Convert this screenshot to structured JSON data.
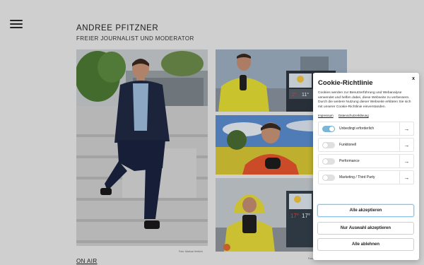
{
  "site": {
    "title": "ANDREE PFITZNER",
    "subtitle": "FREIER JOURNALIST UND MODERATOR",
    "on_air": "ON AIR"
  },
  "photos": {
    "main_credit": "Foto: Markus Hertrich",
    "br_credit": "Foto: SWR/Peter"
  },
  "cookie": {
    "close": "x",
    "title": "Cookie-Richtlinie",
    "text": "Cookies werden zur Benutzerführung und Webanalyse verwendet und helfen dabei, diese Webseite zu verbessern. Durch die weitere Nutzung dieser Webseite erklären Sie sich mit unserer Cookie-Richtlinie einverstanden.",
    "links": [
      "Impressum",
      "Datenschutzerklärung"
    ],
    "categories": [
      {
        "label": "Unbedingt erforderlich",
        "enabled": true
      },
      {
        "label": "Funktionell",
        "enabled": false
      },
      {
        "label": "Performance",
        "enabled": false
      },
      {
        "label": "Marketing / Third Party",
        "enabled": false
      }
    ],
    "buttons": {
      "accept": "Alle akzeptieren",
      "selection": "Nur Auswahl akzeptieren",
      "reject": "Alle ablehnen"
    }
  }
}
